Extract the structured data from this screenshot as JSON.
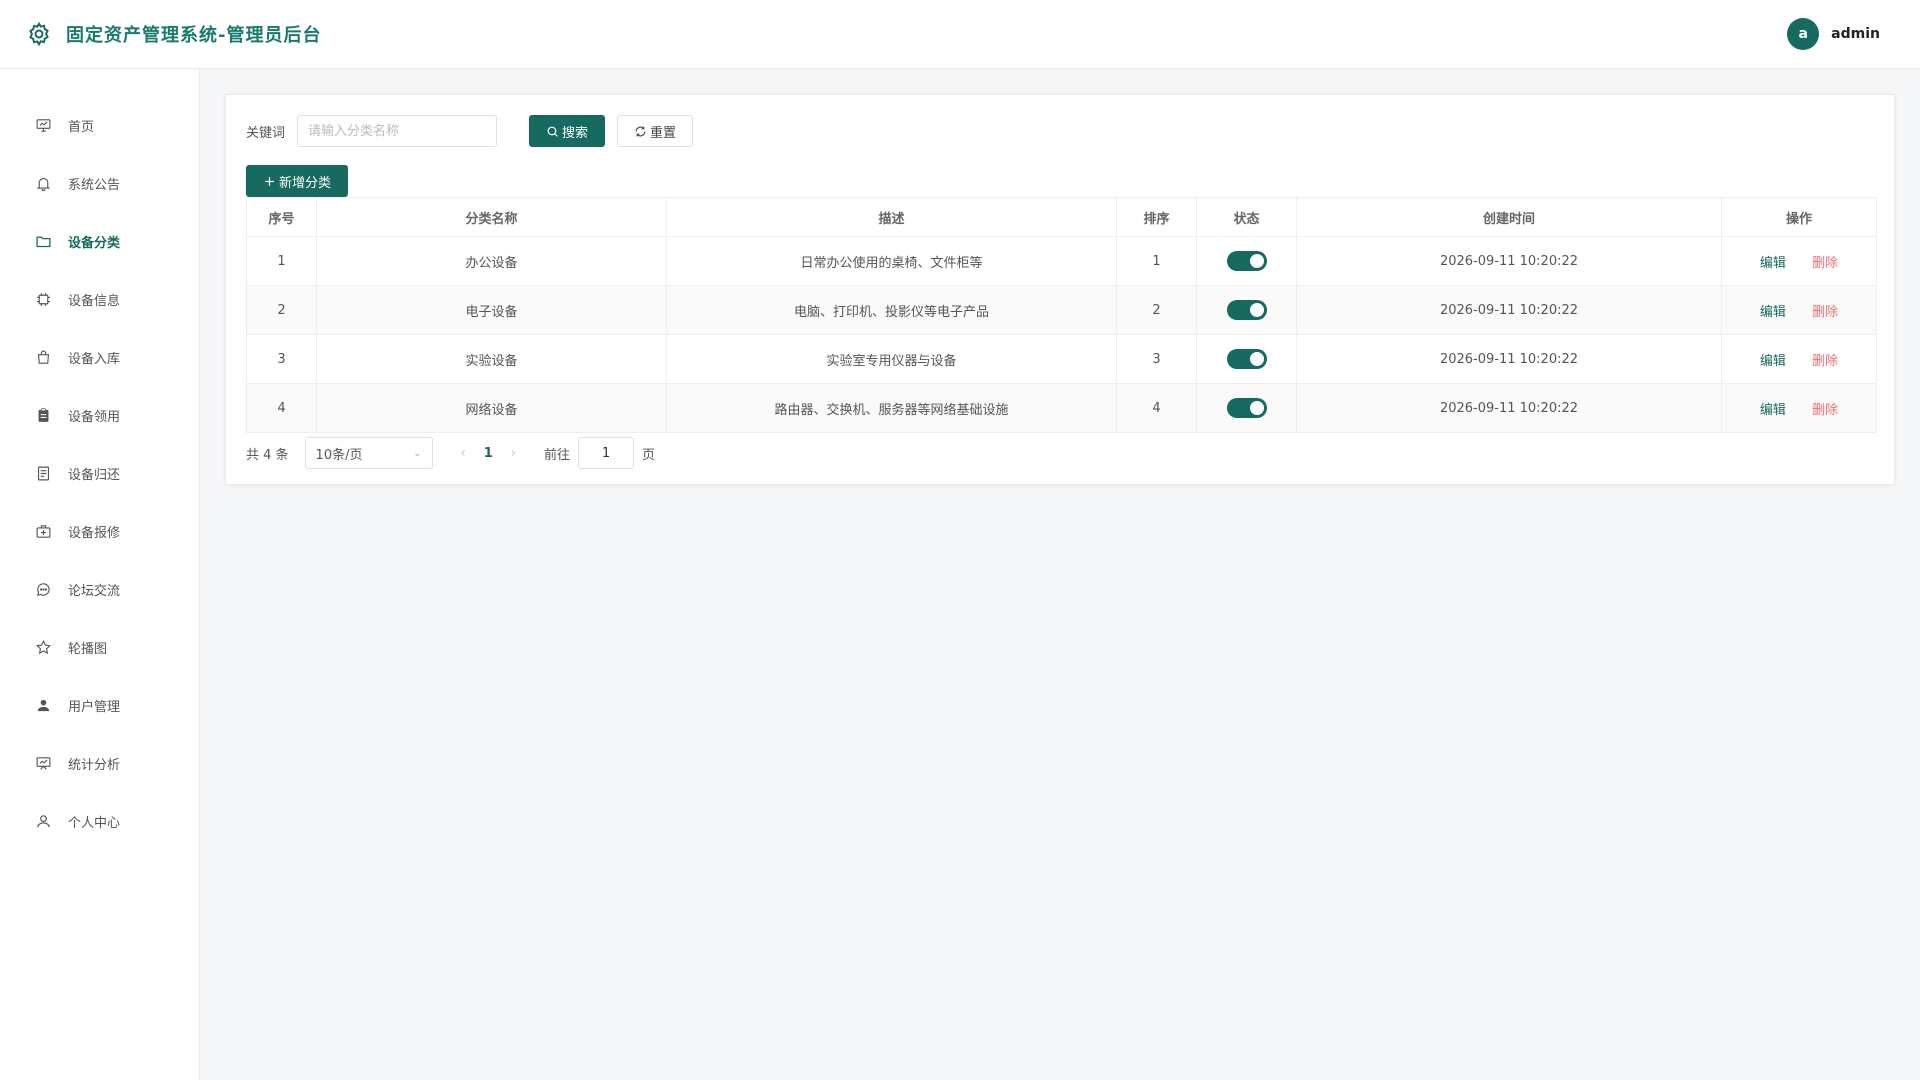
{
  "header": {
    "title": "固定资产管理系统-管理员后台",
    "avatar_letter": "a",
    "username": "admin"
  },
  "sidebar": {
    "items": [
      {
        "label": "首页",
        "icon": "dashboard-icon"
      },
      {
        "label": "系统公告",
        "icon": "bell-icon"
      },
      {
        "label": "设备分类",
        "icon": "folder-icon",
        "active": true
      },
      {
        "label": "设备信息",
        "icon": "chip-icon"
      },
      {
        "label": "设备入库",
        "icon": "shopping-bag-icon"
      },
      {
        "label": "设备领用",
        "icon": "clipboard-icon"
      },
      {
        "label": "设备归还",
        "icon": "document-icon"
      },
      {
        "label": "设备报修",
        "icon": "first-aid-kit-icon"
      },
      {
        "label": "论坛交流",
        "icon": "chat-icon"
      },
      {
        "label": "轮播图",
        "icon": "star-icon"
      },
      {
        "label": "用户管理",
        "icon": "user-filled-icon"
      },
      {
        "label": "统计分析",
        "icon": "presentation-icon"
      },
      {
        "label": "个人中心",
        "icon": "user-icon"
      }
    ]
  },
  "search": {
    "label": "关键词",
    "placeholder": "请输入分类名称",
    "value": "",
    "search_label": "搜索",
    "reset_label": "重置"
  },
  "add_label": "新增分类",
  "table": {
    "columns": [
      "序号",
      "分类名称",
      "描述",
      "排序",
      "状态",
      "创建时间",
      "操作"
    ],
    "rows": [
      {
        "index": "1",
        "name": "办公设备",
        "desc": "日常办公使用的桌椅、文件柜等",
        "sort": "1",
        "enabled": true,
        "created": "2026-09-11 10:20:22"
      },
      {
        "index": "2",
        "name": "电子设备",
        "desc": "电脑、打印机、投影仪等电子产品",
        "sort": "2",
        "enabled": true,
        "created": "2026-09-11 10:20:22"
      },
      {
        "index": "3",
        "name": "实验设备",
        "desc": "实验室专用仪器与设备",
        "sort": "3",
        "enabled": true,
        "created": "2026-09-11 10:20:22"
      },
      {
        "index": "4",
        "name": "网络设备",
        "desc": "路由器、交换机、服务器等网络基础设施",
        "sort": "4",
        "enabled": true,
        "created": "2026-09-11 10:20:22"
      }
    ],
    "edit_label": "编辑",
    "delete_label": "删除"
  },
  "pagination": {
    "total_text": "共 4 条",
    "page_size": "10条/页",
    "current_page": "1",
    "goto_label": "前往",
    "goto_value": "1",
    "page_unit": "页"
  },
  "colors": {
    "primary": "#166a60",
    "danger": "#f56c6c"
  }
}
